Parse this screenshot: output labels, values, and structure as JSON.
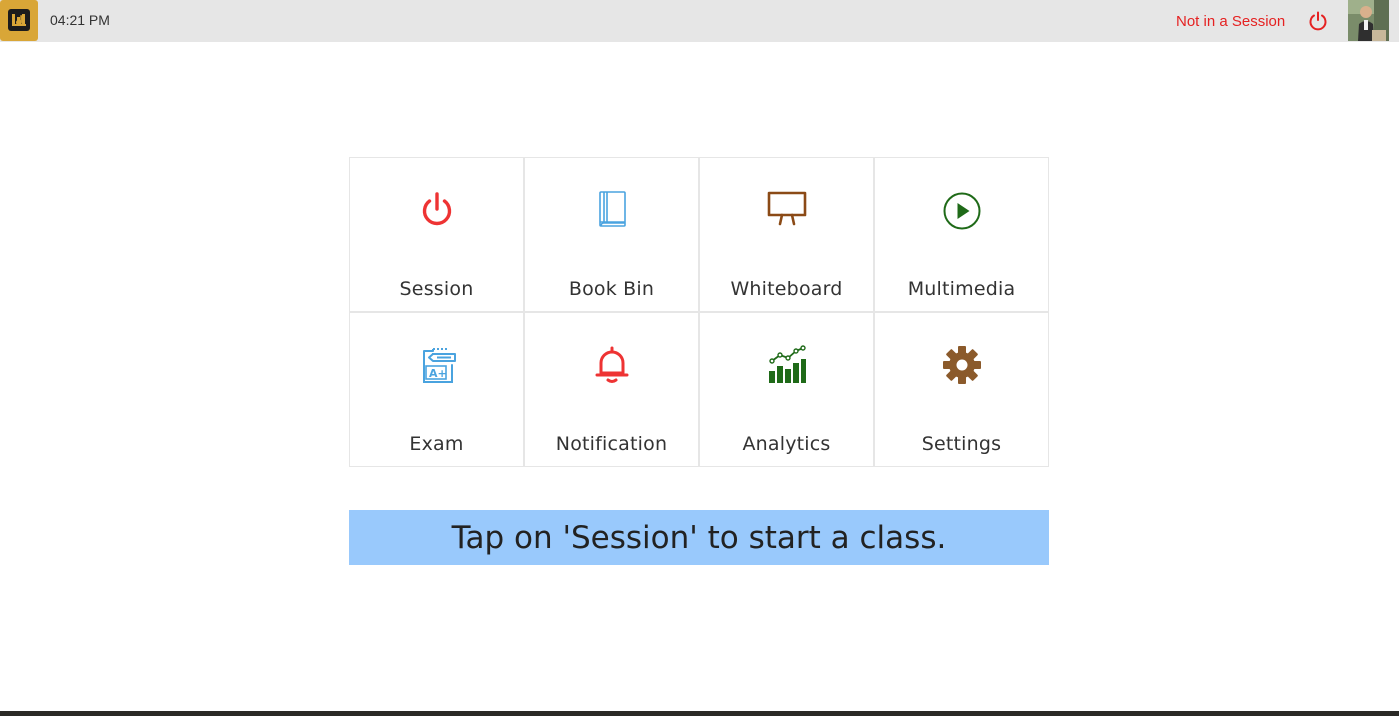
{
  "header": {
    "app_logo_icon": "app-logo-icon",
    "time": "04:21 PM",
    "session_status": "Not in a Session",
    "power_icon": "power-icon",
    "status_color": "#e52222",
    "logo_color": "#d9a637"
  },
  "tiles": [
    {
      "label": "Session",
      "icon": "power-icon",
      "color": "#ee3333"
    },
    {
      "label": "Book Bin",
      "icon": "book-icon",
      "color": "#4aa3df"
    },
    {
      "label": "Whiteboard",
      "icon": "whiteboard-icon",
      "color": "#8b4a16"
    },
    {
      "label": "Multimedia",
      "icon": "play-circle-icon",
      "color": "#1f6a18"
    },
    {
      "label": "Exam",
      "icon": "exam-icon",
      "color": "#4aa3df"
    },
    {
      "label": "Notification",
      "icon": "bell-icon",
      "color": "#ee3333"
    },
    {
      "label": "Analytics",
      "icon": "analytics-chart-icon",
      "color": "#1f6a18"
    },
    {
      "label": "Settings",
      "icon": "gear-icon",
      "color": "#8b5a2b"
    }
  ],
  "banner": {
    "text": "Tap on 'Session' to start a class.",
    "color": "#99c9fc"
  }
}
